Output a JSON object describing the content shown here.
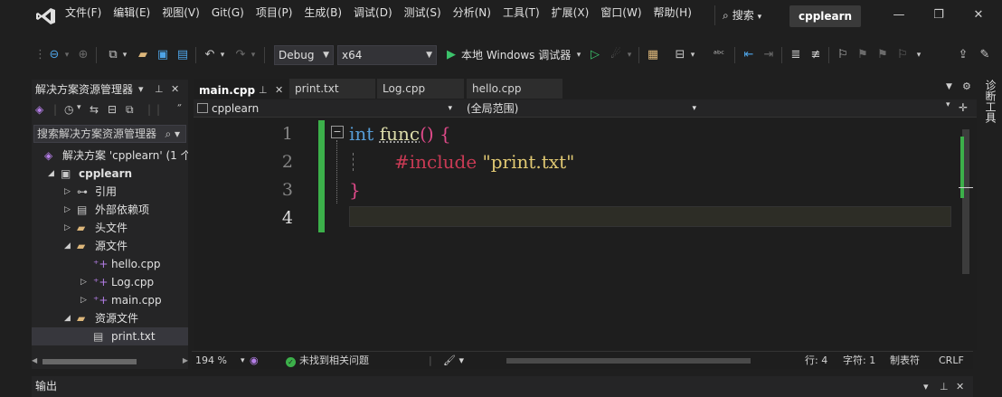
{
  "menu": {
    "items": [
      "文件(F)",
      "编辑(E)",
      "视图(V)",
      "Git(G)",
      "项目(P)",
      "生成(B)",
      "调试(D)",
      "测试(S)",
      "分析(N)",
      "工具(T)",
      "扩展(X)",
      "窗口(W)",
      "帮助(H)"
    ],
    "search_label": "搜索",
    "project_name": "cpplearn"
  },
  "toolbar": {
    "config": "Debug",
    "platform": "x64",
    "run_label": "本地 Windows 调试器"
  },
  "solution_explorer": {
    "title": "解决方案资源管理器",
    "search_placeholder": "搜索解决方案资源管理器",
    "tree": [
      {
        "label": "解决方案 'cpplearn' (1 个",
        "depth": 0,
        "icon": "solution-icon",
        "expander": "none"
      },
      {
        "label": "cpplearn",
        "depth": 1,
        "icon": "cpp-project-icon",
        "expander": "expanded",
        "bold": true
      },
      {
        "label": "引用",
        "depth": 2,
        "icon": "references-icon",
        "expander": "collapsed"
      },
      {
        "label": "外部依赖项",
        "depth": 2,
        "icon": "external-deps-icon",
        "expander": "collapsed"
      },
      {
        "label": "头文件",
        "depth": 2,
        "icon": "folder-icon",
        "expander": "collapsed"
      },
      {
        "label": "源文件",
        "depth": 2,
        "icon": "folder-icon",
        "expander": "expanded"
      },
      {
        "label": "hello.cpp",
        "depth": 3,
        "icon": "cpp-file-icon",
        "expander": "none"
      },
      {
        "label": "Log.cpp",
        "depth": 3,
        "icon": "cpp-file-icon",
        "expander": "collapsed"
      },
      {
        "label": "main.cpp",
        "depth": 3,
        "icon": "cpp-file-icon",
        "expander": "collapsed"
      },
      {
        "label": "资源文件",
        "depth": 2,
        "icon": "folder-icon",
        "expander": "expanded"
      },
      {
        "label": "print.txt",
        "depth": 3,
        "icon": "text-file-icon",
        "expander": "none",
        "selected": true
      }
    ]
  },
  "editor": {
    "tabs": [
      {
        "label": "main.cpp",
        "active": true
      },
      {
        "label": "print.txt",
        "active": false
      },
      {
        "label": "Log.cpp",
        "active": false
      },
      {
        "label": "hello.cpp",
        "active": false
      }
    ],
    "nav_project": "cpplearn",
    "nav_scope": "(全局范围)",
    "line_numbers": [
      "1",
      "2",
      "3",
      "4"
    ],
    "code": {
      "l1_kw": "int",
      "l1_fn": "func",
      "l1_paren": "()",
      "l1_brace": "{",
      "l2_pp": "#include",
      "l2_str": "\"print.txt\"",
      "l3_brace": "}"
    }
  },
  "status": {
    "zoom": "194 %",
    "issues": "未找到相关问题",
    "line": "行: 4",
    "col": "字符: 1",
    "indent": "制表符",
    "eol": "CRLF"
  },
  "diagnostics_label": "诊断工具",
  "output_label": "输出"
}
